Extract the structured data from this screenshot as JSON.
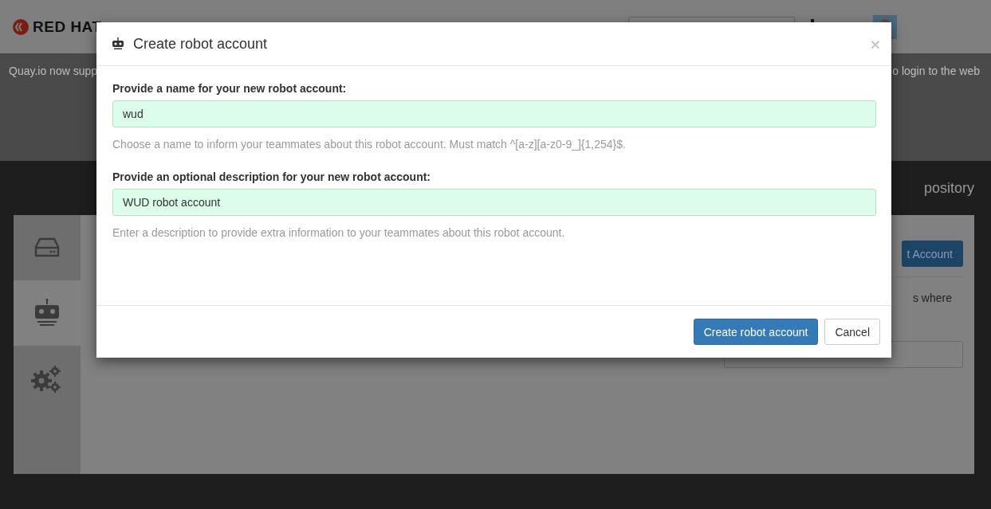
{
  "header": {
    "logo": "RED HAT"
  },
  "banner": {
    "left_text": "Quay.io now supp",
    "right_text": "o login to the web"
  },
  "page": {
    "title_fragment": "pository"
  },
  "sidebar": {
    "tabs": [
      {
        "kind": "drive",
        "selected": false
      },
      {
        "kind": "robot",
        "selected": true
      },
      {
        "kind": "gears",
        "selected": false
      }
    ]
  },
  "content": {
    "create_button": "t Account",
    "description_fragment": "s where"
  },
  "modal": {
    "title": "Create robot account",
    "fields": [
      {
        "label": "Provide a name for your new robot account:",
        "value": "wud",
        "help": "Choose a name to inform your teammates about this robot account. Must match ^[a-z][a-z0-9_]{1,254}$."
      },
      {
        "label": "Provide an optional description for your new robot account:",
        "value": "WUD robot account",
        "help": "Enter a description to provide extra information to your teammates about this robot account."
      }
    ],
    "buttons": [
      {
        "label": "Create robot account",
        "kind": "primary"
      },
      {
        "label": "Cancel",
        "kind": "default"
      }
    ],
    "close": "×"
  }
}
